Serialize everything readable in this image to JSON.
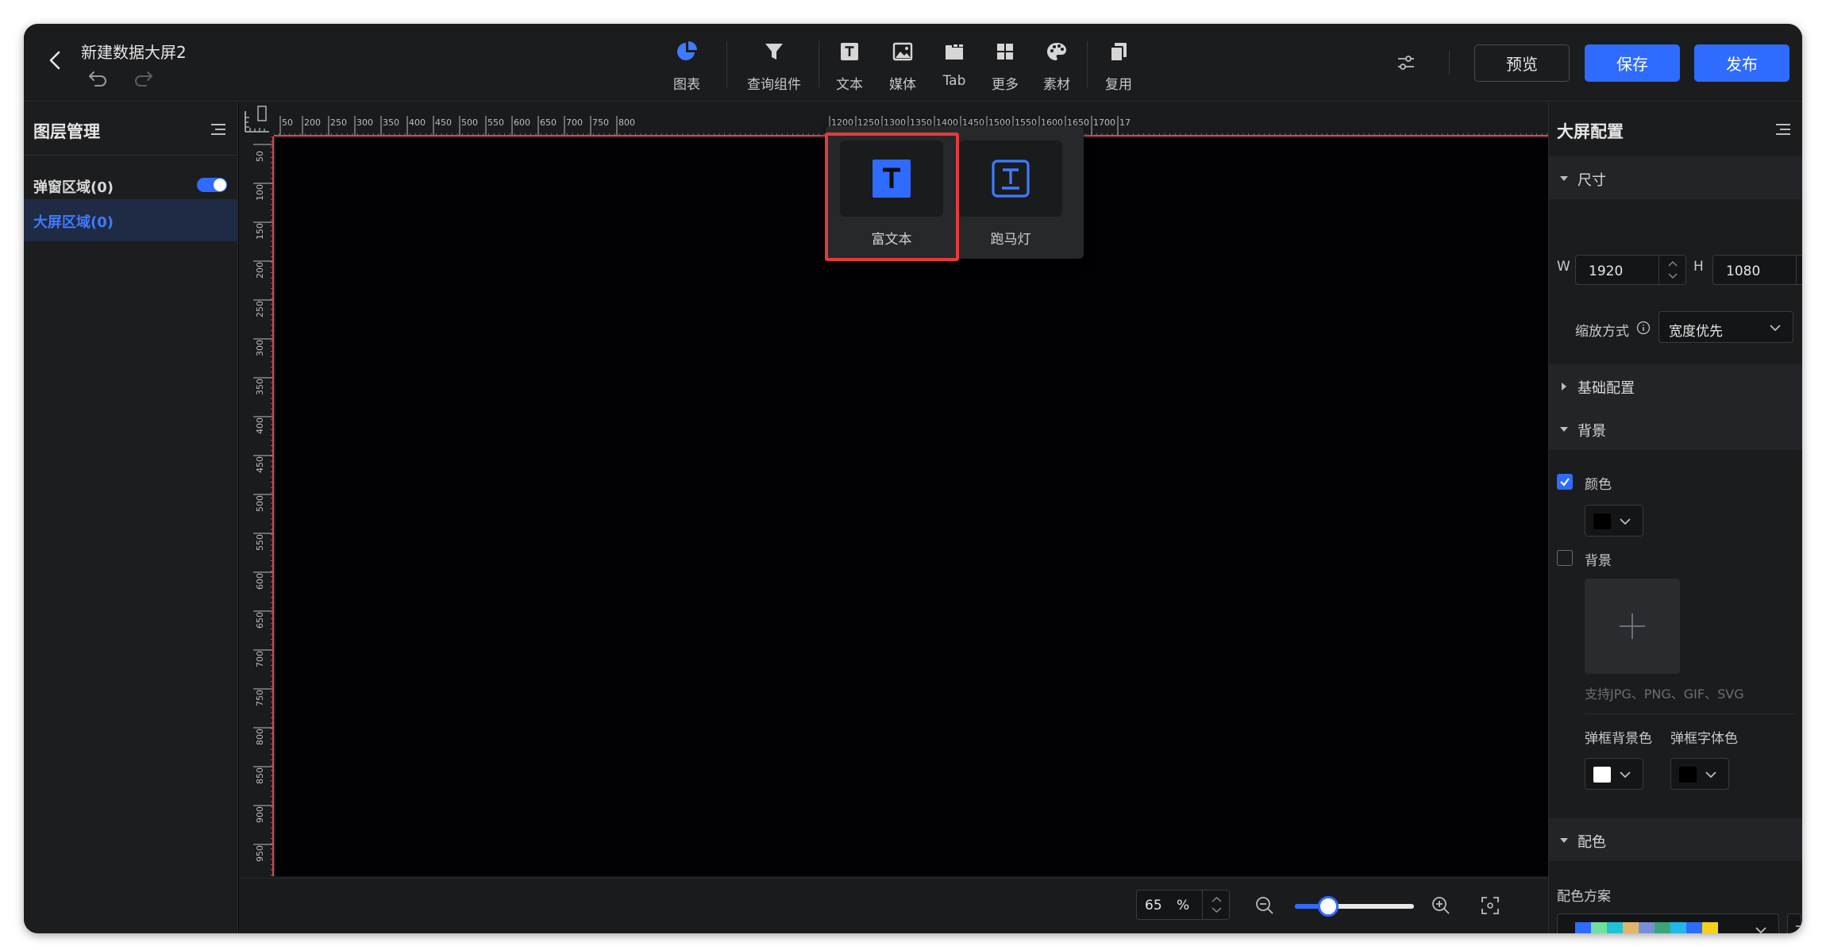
{
  "header": {
    "title": "新建数据大屏2",
    "tools": [
      {
        "label": "图表",
        "icon": "pie-chart-icon"
      },
      {
        "label": "查询组件",
        "icon": "filter-icon"
      },
      {
        "label": "文本",
        "icon": "text-icon"
      },
      {
        "label": "媒体",
        "icon": "image-icon"
      },
      {
        "label": "Tab",
        "icon": "tab-icon"
      },
      {
        "label": "更多",
        "icon": "grid-icon"
      },
      {
        "label": "素材",
        "icon": "palette-icon"
      },
      {
        "label": "复用",
        "icon": "copy-icon"
      }
    ],
    "preview_label": "预览",
    "save_label": "保存",
    "publish_label": "发布"
  },
  "left_panel": {
    "title": "图层管理",
    "popup_zone_label": "弹窗区域(0)",
    "popup_zone_enabled": true,
    "screen_zone_label": "大屏区域(0)"
  },
  "rulers": {
    "horizontal_ticks": [
      "50",
      "200",
      "250",
      "300",
      "350",
      "400",
      "450",
      "500",
      "550",
      "600",
      "650",
      "700",
      "750",
      "800",
      "1200",
      "1250",
      "1300",
      "1350",
      "1400",
      "1450",
      "1500",
      "1550",
      "1600",
      "1650",
      "1700",
      "17"
    ],
    "vertical_ticks": [
      "50",
      "100",
      "150",
      "200",
      "250",
      "300",
      "350",
      "400",
      "450",
      "500",
      "550",
      "600",
      "650",
      "700",
      "750",
      "800",
      "850",
      "900",
      "950"
    ]
  },
  "statusbar": {
    "zoom_value": "65",
    "zoom_unit": "%",
    "zoom_level": 0.28
  },
  "text_popup": {
    "items": [
      {
        "label": "富文本",
        "icon": "rich-text-icon",
        "highlighted": true
      },
      {
        "label": "跑马灯",
        "icon": "marquee-icon",
        "highlighted": false
      }
    ]
  },
  "right_panel": {
    "title": "大屏配置",
    "size_section": "尺寸",
    "width_label": "W",
    "width_value": "1920",
    "height_label": "H",
    "height_value": "1080",
    "scale_label": "缩放方式",
    "scale_value": "宽度优先",
    "basic_section": "基础配置",
    "background_section": "背景",
    "color_checkbox_label": "颜色",
    "color_checked": true,
    "bg_color": "#000000",
    "image_checkbox_label": "背景",
    "image_checked": false,
    "upload_hint": "支持JPG、PNG、GIF、SVG",
    "dialog_bg_label": "弹框背景色",
    "dialog_bg_color": "#ffffff",
    "dialog_font_label": "弹框字体色",
    "dialog_font_color": "#000000",
    "palette_section": "配色",
    "palette_label": "配色方案",
    "palette_colors": [
      "#2f6bff",
      "#6fe0a0",
      "#21c2d6",
      "#e0b56a",
      "#7b8fd6",
      "#3aa57a",
      "#1fb8e8",
      "#2f6bff",
      "#f4d21a"
    ]
  },
  "colors": {
    "accent": "#2f6bff",
    "highlight_border": "#e63a3a",
    "ruler_line": "#e0434d"
  }
}
